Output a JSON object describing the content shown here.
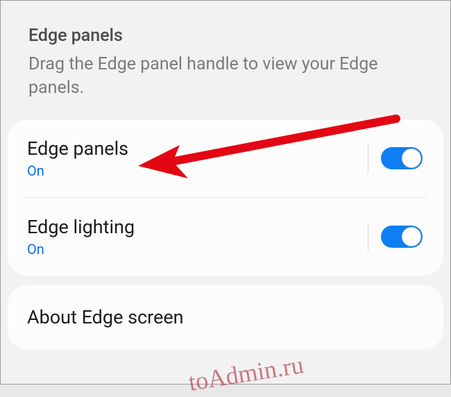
{
  "header": {
    "title": "Edge panels",
    "description": "Drag the Edge panel handle to view your Edge panels."
  },
  "group1": {
    "items": [
      {
        "label": "Edge panels",
        "status": "On",
        "toggled": true
      },
      {
        "label": "Edge lighting",
        "status": "On",
        "toggled": true
      }
    ]
  },
  "group2": {
    "items": [
      {
        "label": "About Edge screen"
      }
    ]
  },
  "watermark": "toAdmin.ru",
  "colors": {
    "accent": "#0d7ff2",
    "status_text": "#0d6ee6"
  }
}
